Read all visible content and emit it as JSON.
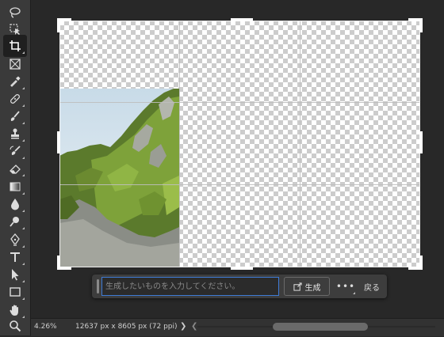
{
  "toolbar": {
    "tools": [
      {
        "name": "lasso-icon",
        "active": false
      },
      {
        "name": "object-selection-icon",
        "active": false
      },
      {
        "name": "crop-icon",
        "active": true
      },
      {
        "name": "frame-icon",
        "active": false
      },
      {
        "name": "eyedropper-icon",
        "active": false
      },
      {
        "name": "healing-brush-icon",
        "active": false
      },
      {
        "name": "brush-icon",
        "active": false
      },
      {
        "name": "clone-stamp-icon",
        "active": false
      },
      {
        "name": "history-brush-icon",
        "active": false
      },
      {
        "name": "eraser-icon",
        "active": false
      },
      {
        "name": "gradient-icon",
        "active": false
      },
      {
        "name": "blur-icon",
        "active": false
      },
      {
        "name": "dodge-icon",
        "active": false
      },
      {
        "name": "pen-icon",
        "active": false
      },
      {
        "name": "type-icon",
        "active": false
      },
      {
        "name": "path-selection-icon",
        "active": false
      },
      {
        "name": "rectangle-icon",
        "active": false
      },
      {
        "name": "hand-icon",
        "active": false
      },
      {
        "name": "zoom-icon",
        "active": false
      }
    ]
  },
  "taskbar": {
    "prompt_placeholder": "生成したいものを入力してください。",
    "generate_label": "生成",
    "more_label": "•••",
    "back_label": "戻る"
  },
  "statusbar": {
    "zoom": "4.26%",
    "doc_size": "12637 px x 8605 px (72 ppi)",
    "arrow_right": "❯",
    "arrow_left": "❮"
  },
  "colors": {
    "accent": "#3e7bd6",
    "toolbar_bg": "#3a3a3a",
    "workspace_bg": "#282828"
  }
}
